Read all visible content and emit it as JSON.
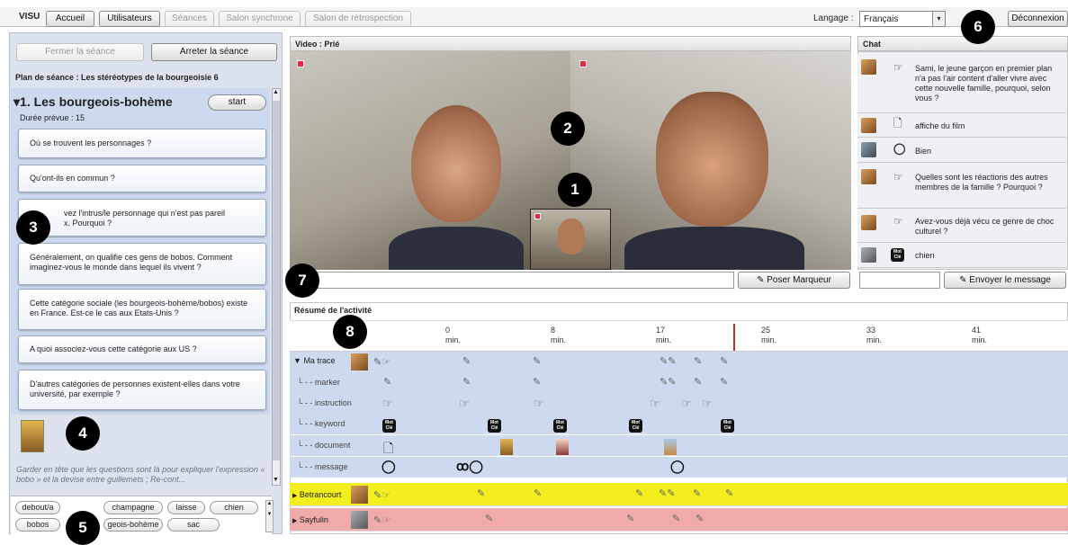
{
  "topbar": {
    "app_name": "VISU",
    "tabs": [
      "Accueil",
      "Utilisateurs",
      "Séances",
      "Salon synchrone",
      "Salon de rétrospection"
    ],
    "language_label": "Langage :",
    "language_value": "Français",
    "logout": "Déconnexion"
  },
  "left": {
    "close_session": "Fermer la séance",
    "stop_session": "Arreter la séance",
    "plan_title": "Plan de séance : Les stéréotypes de la bourgeoisie 6",
    "section_title": "▾1. Les bourgeois-bohème",
    "start": "start",
    "duration": "Durée prévue : 15",
    "questions": [
      "Où se trouvent les personnages ?",
      "Qu'ont-ils en commun ?",
      "vez l'intrus/le personnage qui n'est pas pareil\nx. Pourquoi ?",
      "Généralement, on qualifie ces gens de bobos. Comment imaginez-vous le monde dans lequel ils vivent ?",
      "Cette catégorie sociale (les bourgeois-bohème/bobos) existe en France. Est-ce le cas aux Etats-Unis ?",
      "A quoi associez-vous cette catégorie aux US ?",
      "D'autres catégories de personnes existent-elles dans votre université, par exemple ?"
    ],
    "note": "Garder en tête que les questions sont là pour expliquer l'expression « bobo » et la devise entre guillemets ; Re-cont...",
    "tags_row1": [
      "debout/a",
      "champagne",
      "laisse",
      "chien"
    ],
    "tags_row2": [
      "bobos",
      "geois-bohème",
      "sac"
    ]
  },
  "video": {
    "title": "Video : Prié",
    "marker_input": "",
    "marker_button": "Poser Marqueur"
  },
  "chat": {
    "title": "Chat",
    "messages": [
      {
        "icon": "☞",
        "text": "Sami, le jeune garçon en premier plan n'a pas l'air content d'aller vivre avec cette nouvelle famille, pourquoi, selon vous ?"
      },
      {
        "icon": "🗋",
        "text": "affiche du film"
      },
      {
        "icon": "◯",
        "text": "Bien"
      },
      {
        "icon": "☞",
        "text": "Quelles sont les réactions des autres membres de la famille ? Pourquoi ?"
      },
      {
        "icon": "☞",
        "text": "Avez-vous déjà vécu ce genre de choc culturel ?"
      },
      {
        "icon": "Mot Clé",
        "text": "chien"
      }
    ],
    "send_button": "Envoyer le message"
  },
  "summary": {
    "title": "Résumé de l'activité",
    "ticks": [
      {
        "v": "0",
        "u": "min."
      },
      {
        "v": "8",
        "u": "min."
      },
      {
        "v": "17",
        "u": "min."
      },
      {
        "v": "25",
        "u": "min."
      },
      {
        "v": "33",
        "u": "min."
      },
      {
        "v": "41",
        "u": "min."
      }
    ],
    "rows": [
      "Ma trace",
      "marker",
      "instruction",
      "keyword",
      "document",
      "message"
    ],
    "users": [
      "Betrancourt",
      "Sayfulin"
    ]
  },
  "callouts": [
    "1",
    "2",
    "3",
    "4",
    "5",
    "6",
    "7",
    "8"
  ],
  "colors": {
    "panel_bg": "#ccd9ee",
    "betrancourt": "#f2ef1d",
    "sayfulin": "#f0aaaa",
    "cursor": "#c0302a"
  }
}
